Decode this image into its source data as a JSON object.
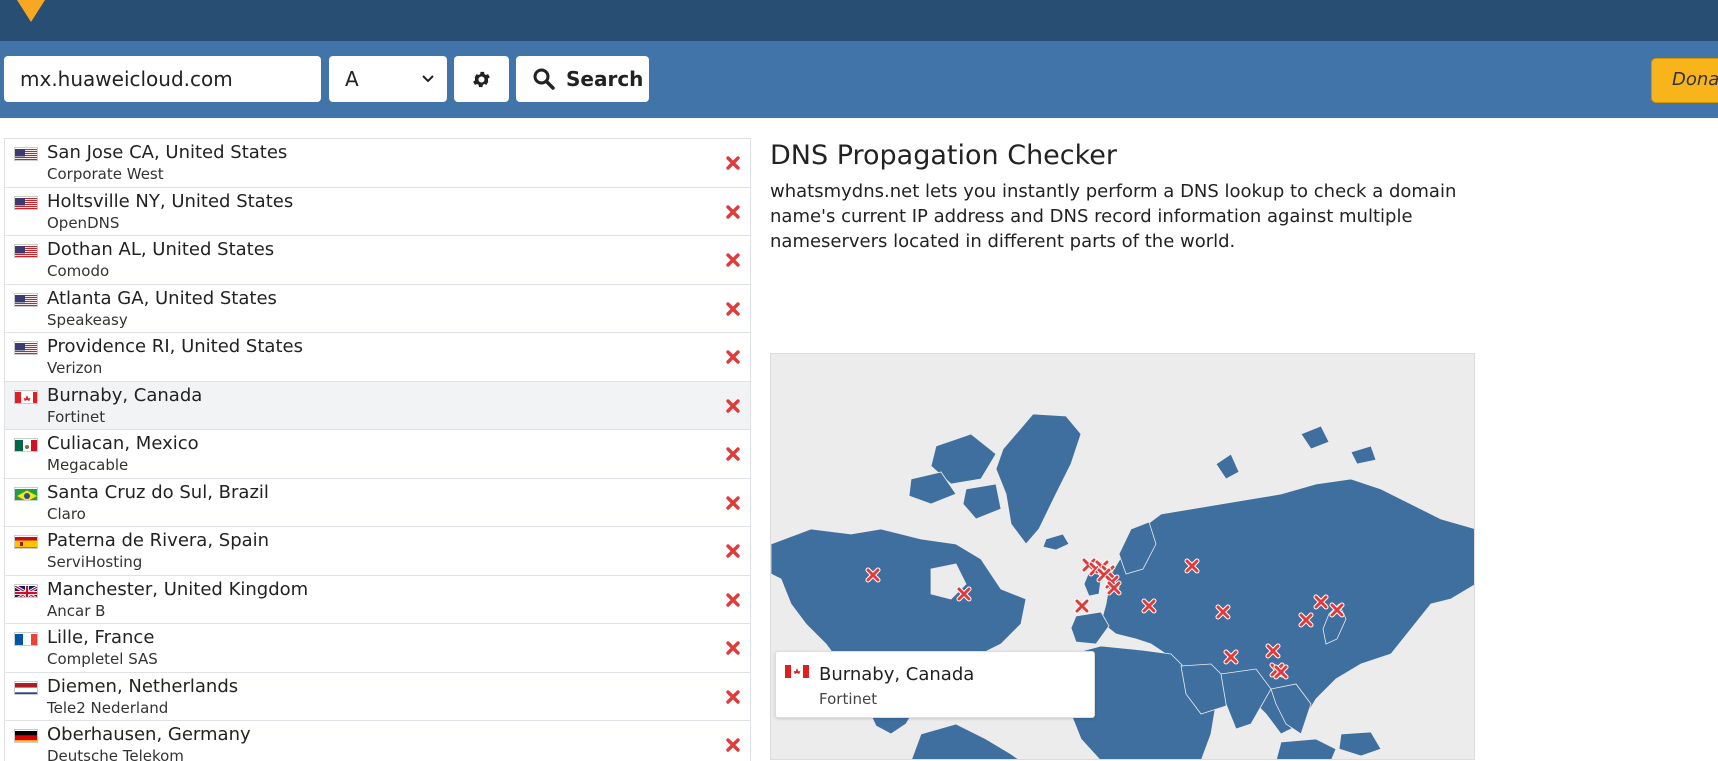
{
  "search": {
    "domain_value": "mx.huaweicloud.com",
    "record_type": "A",
    "search_label": "Search",
    "donate_label": "Donate"
  },
  "main": {
    "title": "DNS Propagation Checker",
    "description": "whatsmydns.net lets you instantly perform a DNS lookup to check a domain name's current IP address and DNS record information against multiple nameservers located in different parts of the world."
  },
  "results": [
    {
      "location": "San Jose CA, United States",
      "provider": "Corporate West",
      "flag": "us",
      "status": "fail"
    },
    {
      "location": "Holtsville NY, United States",
      "provider": "OpenDNS",
      "flag": "us",
      "status": "fail"
    },
    {
      "location": "Dothan AL, United States",
      "provider": "Comodo",
      "flag": "us",
      "status": "fail"
    },
    {
      "location": "Atlanta GA, United States",
      "provider": "Speakeasy",
      "flag": "us",
      "status": "fail"
    },
    {
      "location": "Providence RI, United States",
      "provider": "Verizon",
      "flag": "us",
      "status": "fail"
    },
    {
      "location": "Burnaby, Canada",
      "provider": "Fortinet",
      "flag": "ca",
      "status": "fail"
    },
    {
      "location": "Culiacan, Mexico",
      "provider": "Megacable",
      "flag": "mx",
      "status": "fail"
    },
    {
      "location": "Santa Cruz do Sul, Brazil",
      "provider": "Claro",
      "flag": "br",
      "status": "fail"
    },
    {
      "location": "Paterna de Rivera, Spain",
      "provider": "ServiHosting",
      "flag": "es",
      "status": "fail"
    },
    {
      "location": "Manchester, United Kingdom",
      "provider": "Ancar B",
      "flag": "gb",
      "status": "fail"
    },
    {
      "location": "Lille, France",
      "provider": "Completel SAS",
      "flag": "fr",
      "status": "fail"
    },
    {
      "location": "Diemen, Netherlands",
      "provider": "Tele2 Nederland",
      "flag": "nl",
      "status": "fail"
    },
    {
      "location": "Oberhausen, Germany",
      "provider": "Deutsche Telekom",
      "flag": "de",
      "status": "fail"
    }
  ],
  "tooltip": {
    "location": "Burnaby, Canada",
    "provider": "Fortinet",
    "flag": "ca"
  },
  "colors": {
    "topbar": "#284e74",
    "searchbar": "#4174a8",
    "land": "#3f6f9f",
    "fail": "#e03a3a",
    "donate": "#f8b51b"
  }
}
